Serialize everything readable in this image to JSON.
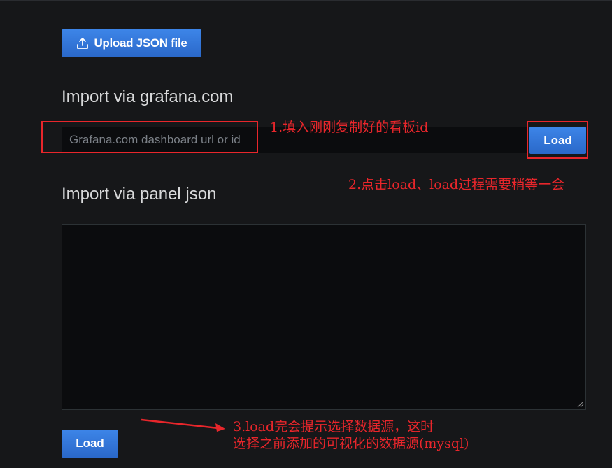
{
  "upload": {
    "label": "Upload JSON file",
    "icon": "upload-icon"
  },
  "grafana_import": {
    "title": "Import via grafana.com",
    "input_value": "",
    "placeholder": "Grafana.com dashboard url or id",
    "load_label": "Load"
  },
  "panel_json": {
    "title": "Import via panel json",
    "value": "",
    "load_label": "Load"
  },
  "annotations": {
    "step1": "1.填入刚刚复制好的看板id",
    "step2": "2.点击load、load过程需要稍等一会",
    "step3_line1": "3.load完会提示选择数据源，这时",
    "step3_line2": "选择之前添加的可视化的数据源(mysql)"
  },
  "colors": {
    "background": "#161719",
    "primary_button": "#3274d9",
    "annotation_red": "#e8262b",
    "input_bg": "#0b0c0e"
  }
}
